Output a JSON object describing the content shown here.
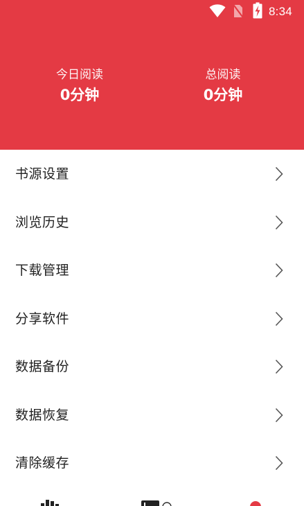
{
  "status_bar": {
    "time": "8:34",
    "icons": [
      "wifi-icon",
      "no-sim-icon",
      "battery-charging-icon"
    ]
  },
  "colors": {
    "accent": "#e43a44",
    "text": "#222222",
    "chevron": "#555555"
  },
  "stats": {
    "today": {
      "label": "今日阅读",
      "value": "0分钟"
    },
    "total": {
      "label": "总阅读",
      "value": "0分钟"
    }
  },
  "menu": {
    "items": [
      {
        "label": "书源设置",
        "icon": "chevron-right-icon"
      },
      {
        "label": "浏览历史",
        "icon": "chevron-right-icon"
      },
      {
        "label": "下载管理",
        "icon": "chevron-right-icon"
      },
      {
        "label": "分享软件",
        "icon": "chevron-right-icon"
      },
      {
        "label": "数据备份",
        "icon": "chevron-right-icon"
      },
      {
        "label": "数据恢复",
        "icon": "chevron-right-icon"
      },
      {
        "label": "清除缓存",
        "icon": "chevron-right-icon"
      }
    ]
  },
  "bottom_nav": {
    "icons": [
      "bookshelf-tab-icon",
      "library-tab-icon",
      "profile-tab-icon"
    ]
  }
}
